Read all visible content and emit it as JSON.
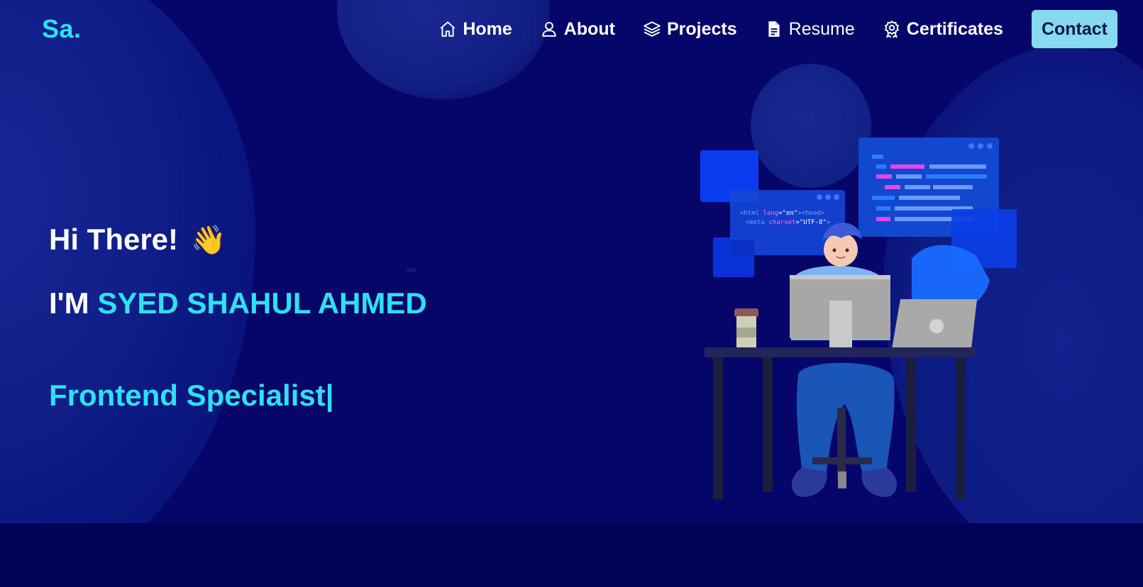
{
  "logo": "Sa.",
  "nav": {
    "items": [
      {
        "label": "Home",
        "icon": "home-icon"
      },
      {
        "label": "About",
        "icon": "user-icon"
      },
      {
        "label": "Projects",
        "icon": "layers-icon"
      },
      {
        "label": "Resume",
        "icon": "document-icon"
      },
      {
        "label": "Certificates",
        "icon": "award-icon"
      }
    ],
    "contact_label": "Contact"
  },
  "hero": {
    "greeting": "Hi There!",
    "wave": "👋",
    "intro": "I'M",
    "name": "SYED SHAHUL AHMED",
    "role": "Frontend Specialist",
    "cursor": "|"
  },
  "illustration": {
    "code_line_1_tag": "<html",
    "code_line_1_attr": "lang",
    "code_line_1_val": "=\"en\"",
    "code_line_1_tail": "><head>",
    "code_line_2_tag": "<meta",
    "code_line_2_attr": "charset",
    "code_line_2_val": "=\"UTF-8\"",
    "code_line_2_tail": ">"
  },
  "colors": {
    "background": "#05056a",
    "accent": "#2fe0f0",
    "contact_button": "#86d9ef"
  }
}
